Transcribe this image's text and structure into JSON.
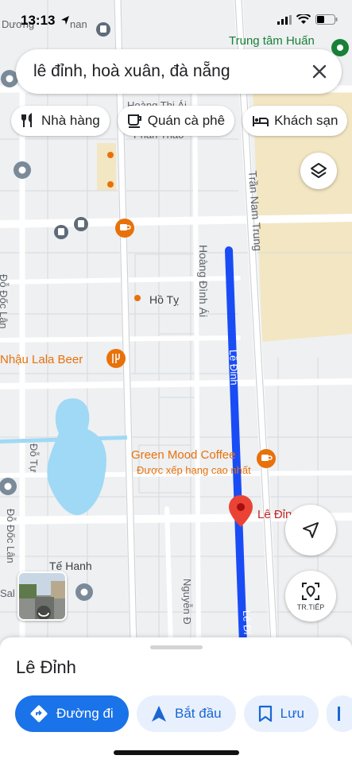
{
  "status_bar": {
    "time": "13:13"
  },
  "search": {
    "query": "lê đỉnh, hoà xuân, đà nẵng"
  },
  "chips": [
    {
      "label": "Nhà hàng",
      "icon": "restaurant-icon"
    },
    {
      "label": "Quán cà phê",
      "icon": "coffee-icon"
    },
    {
      "label": "Khách sạn",
      "icon": "hotel-icon"
    }
  ],
  "map": {
    "streets": {
      "top_left": "Dương",
      "top_left_2": "nan",
      "pham_thi_ai": "Hoàng Thị Ái",
      "phan_thao": "Phan Thao",
      "tran_nam_trung": "Trần Nam Trung",
      "hoang_dinh_ai": "Hoàng Đình Ái",
      "ho_ty": "Hồ Tỵ",
      "le_dinh": "Lê Đỉnh",
      "le_dinh_2": "Lê Đỉ",
      "do_tu": "Đỗ Tự",
      "do_doc_loan": "Đỗ Đốc Lân",
      "do_doc_loan_top": "Đỗ Đốc Lân",
      "te_hanh": "Tế Hanh",
      "nguyen_d": "Nguyễn Đ",
      "sal": "Sal"
    },
    "pois": {
      "trung_tam": "Trung tâm Huấn",
      "lala_beer": "Nhậu Lala Beer",
      "green_mood": "Green Mood Coffee",
      "green_mood_sub": "Được xếp hạng cao nhất",
      "pin_label": "Lê Đỉn"
    },
    "colors": {
      "route": "#1a4cf5",
      "pin": "#ea4335",
      "poi_orange": "#e8710a",
      "water": "#9fd9f5",
      "sand": "#f3e6c2",
      "road": "#ffffff",
      "poi_green": "#188038"
    }
  },
  "controls": {
    "next_label": "TR.TIẾP"
  },
  "place": {
    "name": "Lê Đỉnh",
    "actions": [
      {
        "label": "Đường đi",
        "icon": "directions-icon"
      },
      {
        "label": "Bắt đầu",
        "icon": "navigation-arrow-icon"
      },
      {
        "label": "Lưu",
        "icon": "bookmark-icon"
      }
    ]
  }
}
